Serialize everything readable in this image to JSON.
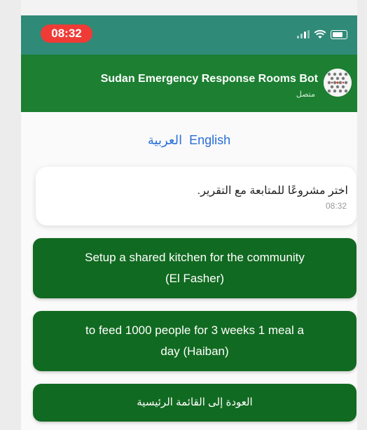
{
  "status_bar": {
    "time": "08:32"
  },
  "chat_header": {
    "title": "Sudan Emergency Response Rooms Bot",
    "status": "متصل"
  },
  "language_options": [
    "العربية",
    "English"
  ],
  "message": {
    "text": "اختر مشروعًا للمتابعة مع التقرير.",
    "time": "08:32"
  },
  "project_buttons": [
    {
      "line1": "Setup a shared kitchen for the community",
      "line2": "(El Fasher)"
    },
    {
      "line1": "to feed 1000 people for 3 weeks 1 meal a",
      "line2": "day (Haiban)"
    }
  ],
  "back_button": {
    "label": "العودة إلى القائمة الرئيسية"
  },
  "colors": {
    "status_bar": "#2f8a78",
    "header": "#1c7f31",
    "button": "#116a21",
    "link": "#2a6ed8",
    "time_pill": "#ef3b36"
  }
}
